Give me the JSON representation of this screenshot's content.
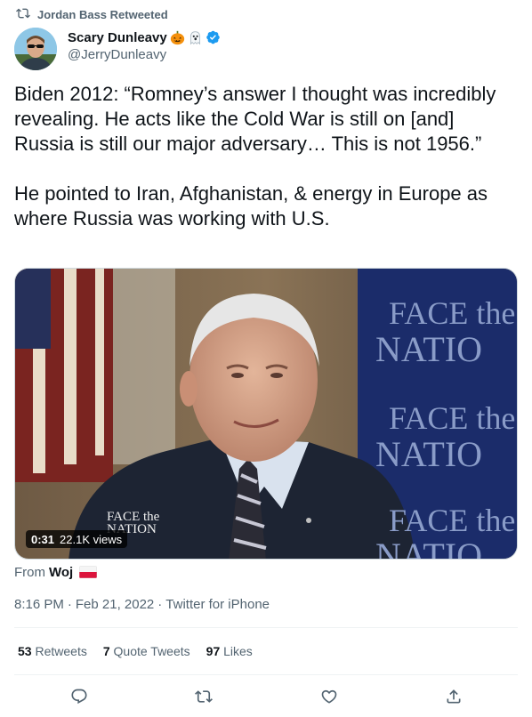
{
  "retweet_banner": {
    "label": "Jordan Bass Retweeted"
  },
  "author": {
    "name": "Scary Dunleavy",
    "handle": "@JerryDunleavy"
  },
  "tweet": {
    "paragraphs": [
      "Biden 2012: “Romney’s answer I thought was incredibly revealing. He acts like the Cold War is still on [and] Russia is still our major adversary… This is not 1956.”",
      "He pointed to Iran, Afghanistan, & energy in Europe as where Russia was working with U.S."
    ]
  },
  "media": {
    "duration": "0:31",
    "views": "22.1K views",
    "backdrop_text": [
      "FACE the",
      "NATIO",
      "FACE the",
      "NATIO",
      "FACE the",
      "NATIO"
    ],
    "watermark": [
      "FACE the",
      "NATION"
    ]
  },
  "source": {
    "prefix": "From",
    "name": "Woj"
  },
  "meta": {
    "time": "8:16 PM",
    "sep1": "·",
    "date": "Feb 21, 2022",
    "sep2": "·",
    "client": "Twitter for iPhone"
  },
  "stats": {
    "retweets": {
      "count": "53",
      "label": "Retweets"
    },
    "quotes": {
      "count": "7",
      "label": "Quote Tweets"
    },
    "likes": {
      "count": "97",
      "label": "Likes"
    }
  },
  "icons": [
    "retweet-icon",
    "pumpkin-icon",
    "ghost-icon",
    "verified-badge-icon",
    "poland-flag-icon",
    "reply-icon",
    "like-icon",
    "share-icon"
  ],
  "colors": {
    "verified": "#1d9bf0",
    "text_secondary": "#536471",
    "text_primary": "#0f1419",
    "divider": "#eff3f4",
    "backdrop_blue": "#1b2c6a"
  }
}
